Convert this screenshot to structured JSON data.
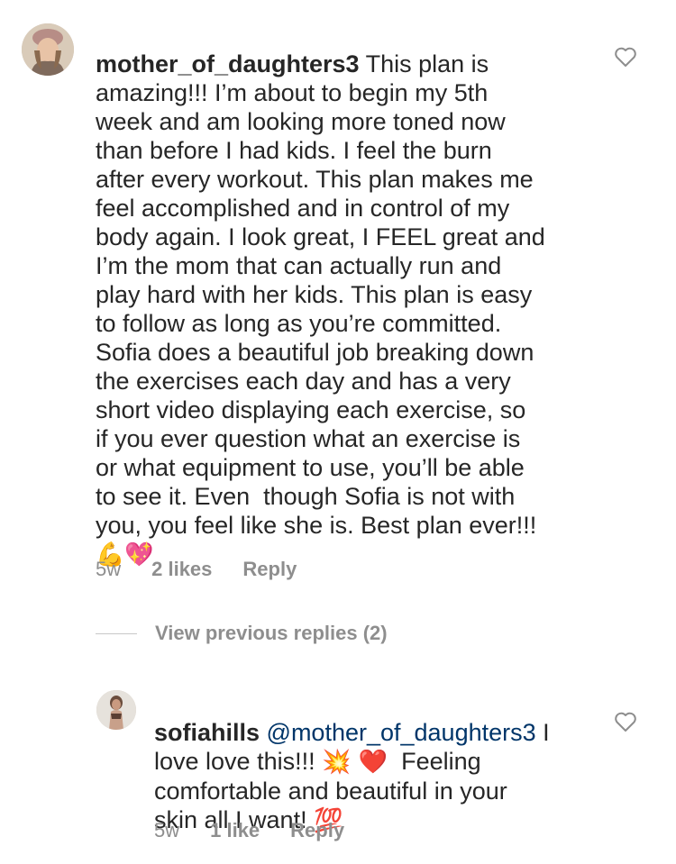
{
  "comment": {
    "username": "mother_of_daughters3",
    "lines": [
      " This plan is",
      "amazing!!! I’m about to begin my 5th",
      "week and am looking more toned now",
      "than before I had kids. I feel the burn",
      "after every workout. This plan makes me",
      "feel accomplished and in control of my",
      "body again. I look great, I FEEL great and",
      "I’m the mom that can actually run and",
      "play hard with her kids. This plan is easy",
      "to follow as long as you’re committed.",
      "Sofia does a beautiful job breaking down",
      "the exercises each day and has a very",
      "short video displaying each exercise, so",
      "if you ever question what an exercise is",
      "or what equipment to use, you’ll be able",
      "to see it. Even  though Sofia is not with",
      "you, you feel like she is. Best plan ever!!!"
    ],
    "emoji_line": "💪💖",
    "time": "5w",
    "likes": "2 likes",
    "reply": "Reply"
  },
  "view_previous": "View previous replies (2)",
  "reply": {
    "username": "sofiahills",
    "mention": " @mother_of_daughters3",
    "line1_end": " I",
    "line2_start": "love love this!!! ",
    "line2_emoji": "💥 ❤️",
    "line2_end": "  Feeling",
    "line3": "comfortable and beautiful in your",
    "line4": "skin all I want! ",
    "line4_emoji": "💯",
    "time": "5w",
    "likes": "1 like",
    "reply": "Reply"
  },
  "icons": {
    "heart": "heart-outline-icon",
    "avatar_main": "profile-photo",
    "avatar_reply": "profile-photo"
  },
  "colors": {
    "text": "#262626",
    "secondary": "#8e8e8e",
    "mention": "#003569"
  }
}
